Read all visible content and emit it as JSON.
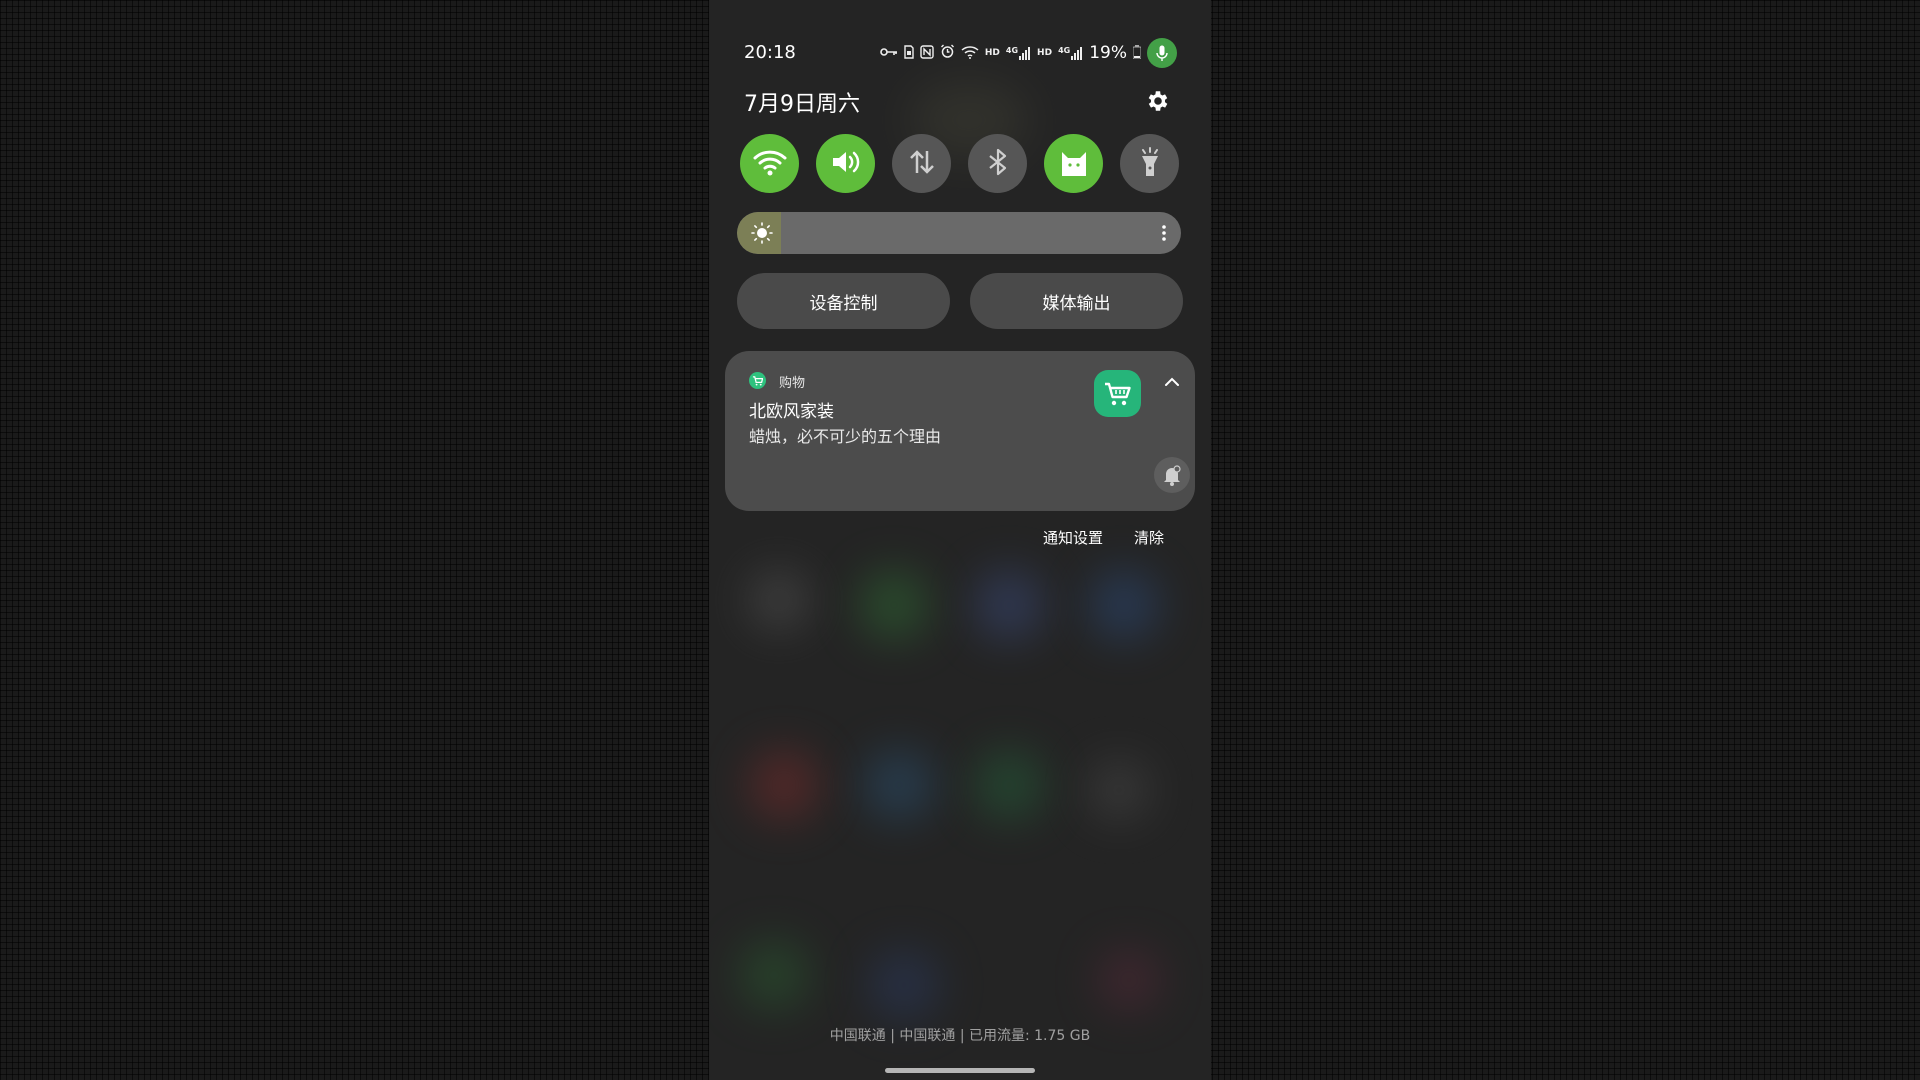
{
  "status_bar": {
    "time": "20:18",
    "battery_percent": "19%",
    "network_label_1": "4G",
    "network_label_2": "4G",
    "hd_label_1": "HD",
    "hd_label_2": "HD",
    "icons": [
      "vpn-key-icon",
      "sim-icon",
      "nfc-icon",
      "alarm-icon",
      "wifi-icon",
      "signal-icon",
      "signal-icon",
      "battery-icon",
      "microphone-icon"
    ]
  },
  "header": {
    "date": "7月9日周六",
    "settings_icon": "gear-icon"
  },
  "quick_tiles": [
    {
      "icon": "wifi-icon",
      "active": true
    },
    {
      "icon": "sound-icon",
      "active": true
    },
    {
      "icon": "mobile-data-icon",
      "active": false
    },
    {
      "icon": "bluetooth-icon",
      "active": false
    },
    {
      "icon": "cat-mode-icon",
      "active": true
    },
    {
      "icon": "flashlight-icon",
      "active": false
    }
  ],
  "brightness": {
    "level": 0.07
  },
  "buttons": {
    "device_control": "设备控制",
    "media_output": "媒体输出"
  },
  "notification": {
    "app_name": "购物",
    "title": "北欧风家装",
    "text": "蜡烛，必不可少的五个理由",
    "app_icon": "shopping-cart-icon"
  },
  "notification_actions": {
    "settings": "通知设置",
    "clear": "清除"
  },
  "footer": {
    "carrier_info": "中国联通 | 中国联通 | 已用流量: 1.75 GB"
  },
  "colors": {
    "tile_active": "#5fbd3b",
    "tile_inactive": "#565656",
    "accent_green": "#26b57a"
  }
}
